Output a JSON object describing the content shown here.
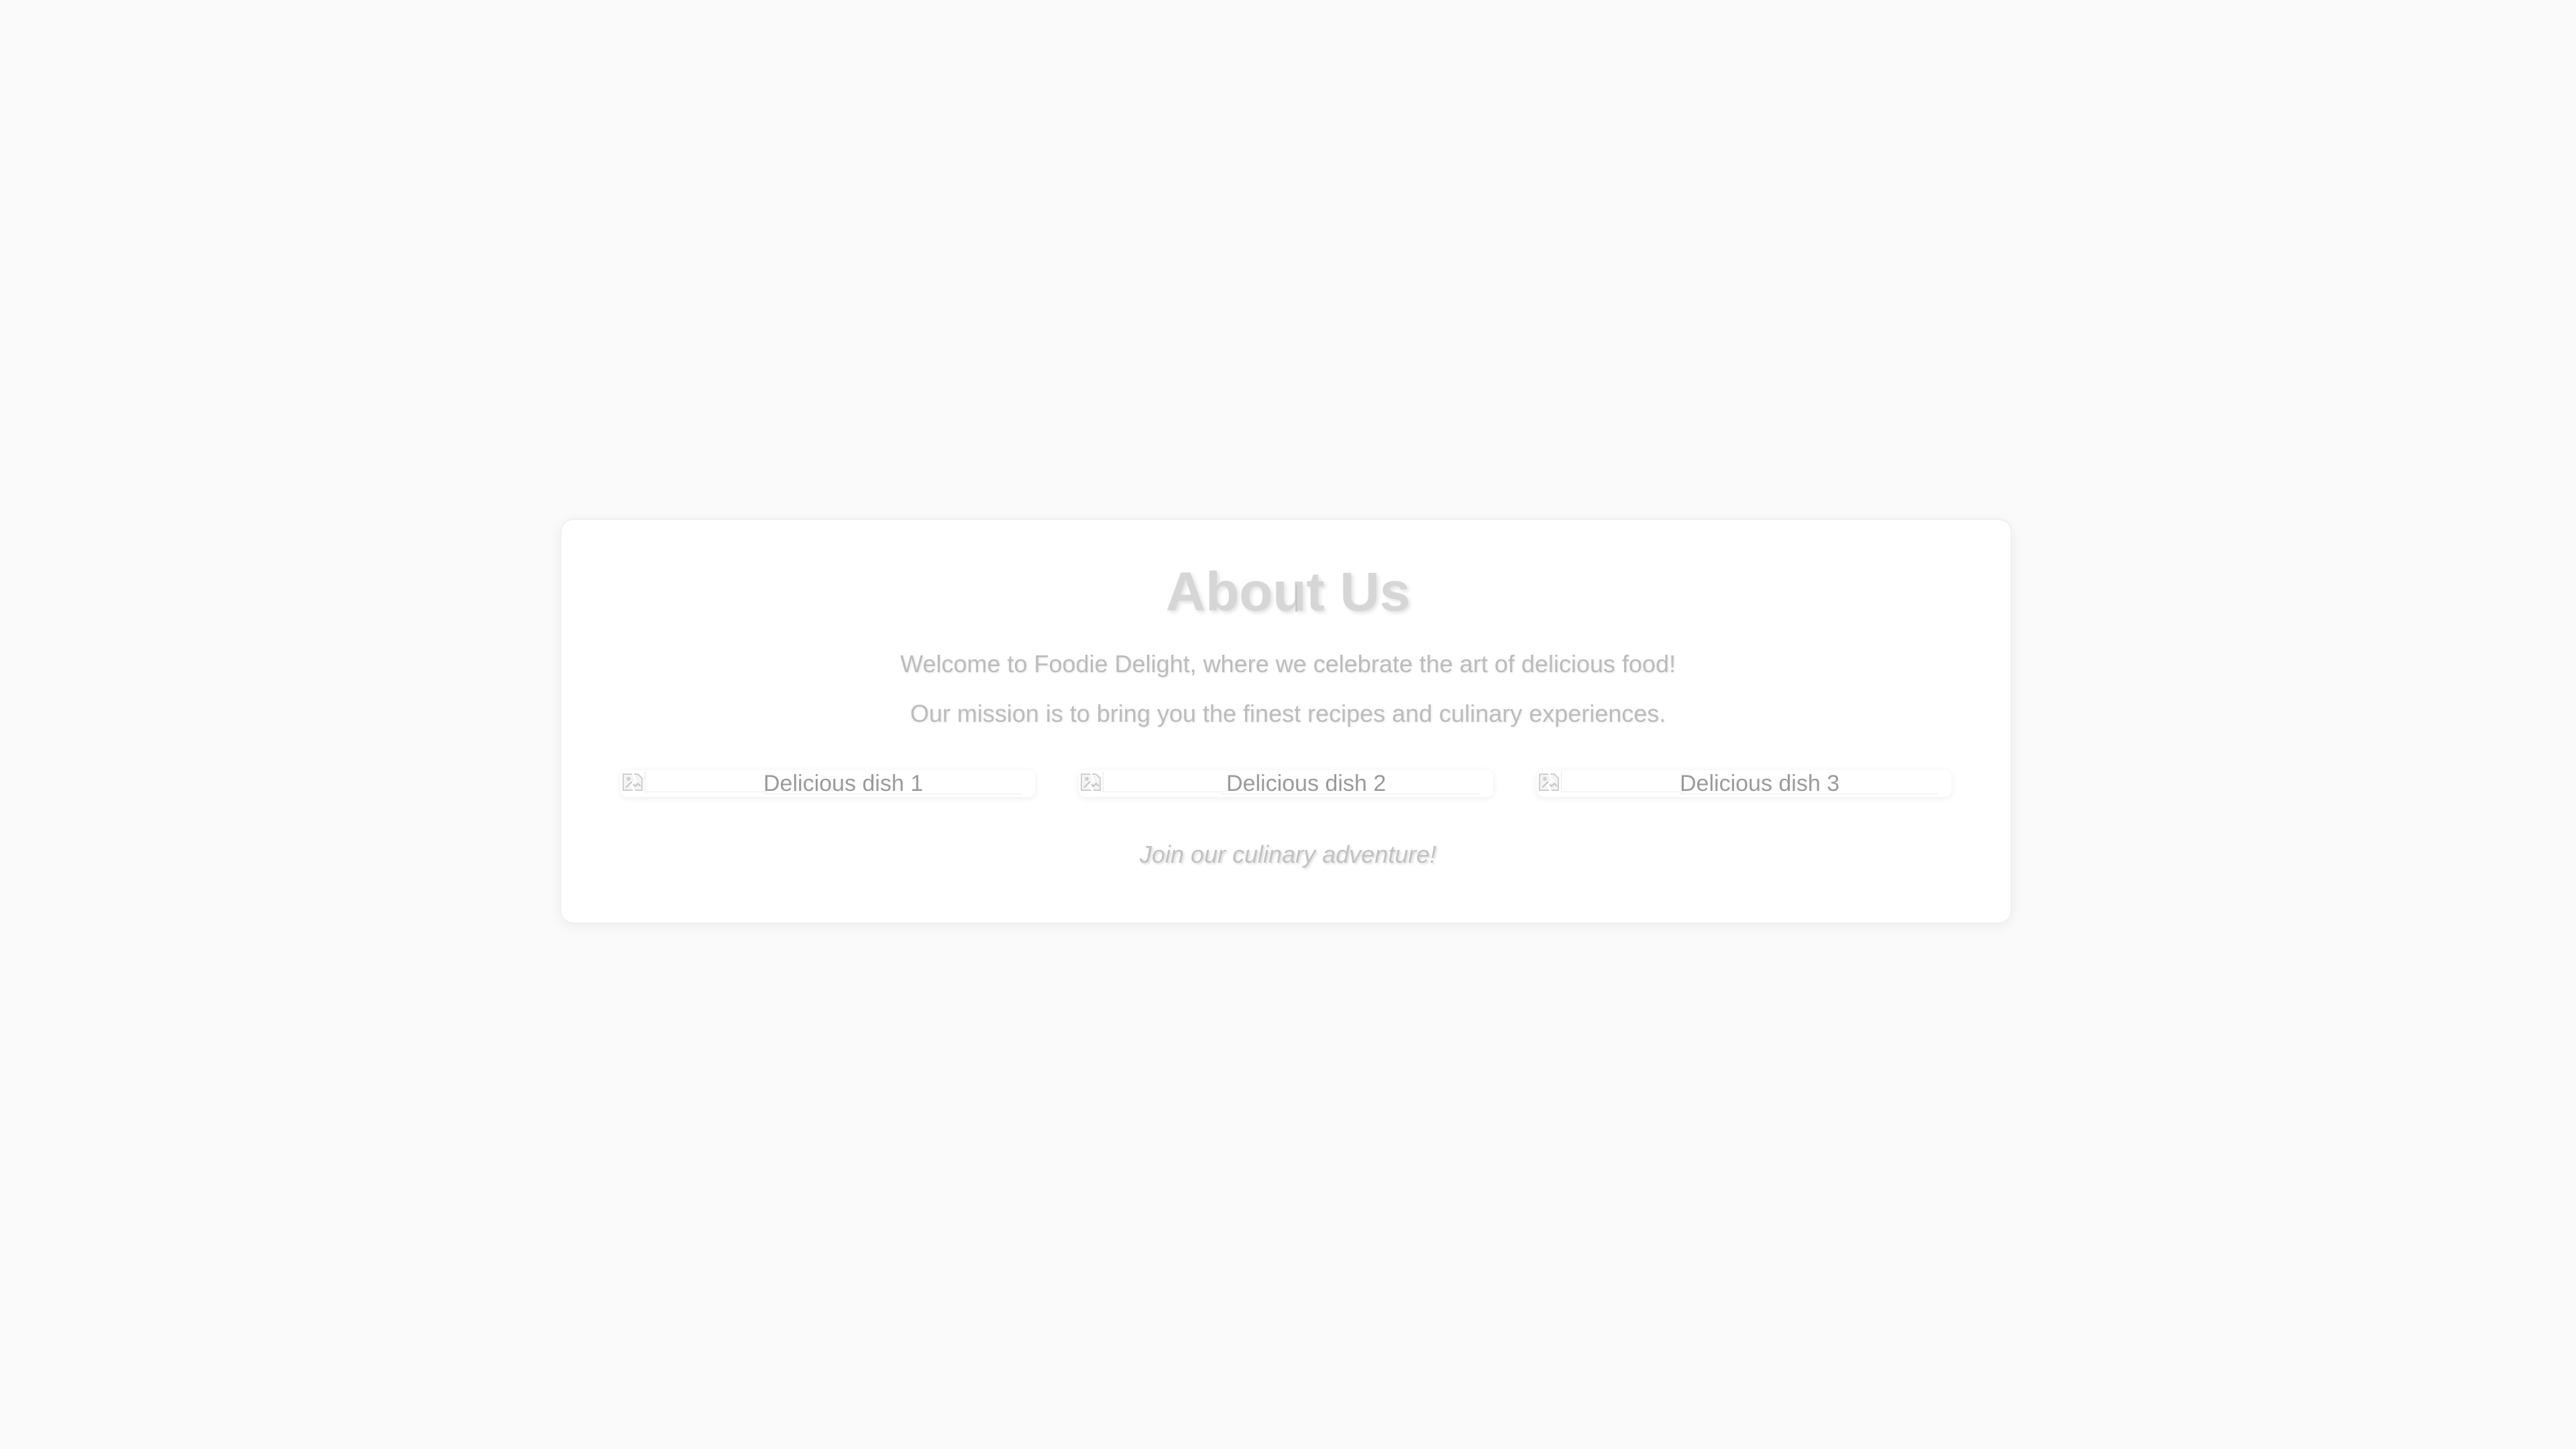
{
  "about": {
    "title": "About Us",
    "intro": "Welcome to Foodie Delight, where we celebrate the art of delicious food!",
    "mission": "Our mission is to bring you the finest recipes and culinary experiences.",
    "footer": "Join our culinary adventure!"
  },
  "gallery": {
    "images": [
      {
        "alt": "Delicious dish 1",
        "icon": "broken-image-icon"
      },
      {
        "alt": "Delicious dish 2",
        "icon": "broken-image-icon"
      },
      {
        "alt": "Delicious dish 3",
        "icon": "broken-image-icon"
      }
    ]
  },
  "colors": {
    "background": "#fafafa",
    "card": "#ffffff",
    "title": "#d6d6d6",
    "text": "#bcbcbc",
    "alt_text": "#9a9a9a"
  }
}
